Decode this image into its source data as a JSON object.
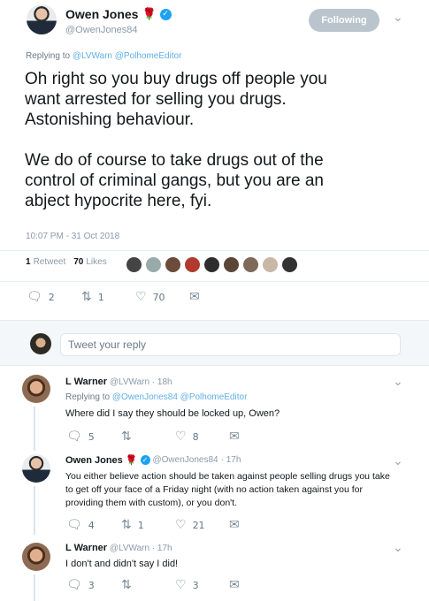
{
  "main_tweet": {
    "author_name": "Owen Jones",
    "handle": "@OwenJones84",
    "follow_label": "Following",
    "replying_to_prefix": "Replying to",
    "replying_to_handles": "@LVWarn @PolhomeEditor",
    "text_line1": "Oh right so you buy drugs off people you",
    "text_line2": "want arrested for selling you drugs.",
    "text_line3": "Astonishing behaviour.",
    "text_line4": "We do of course to take drugs out of the",
    "text_line5": "control of criminal gangs, but you are an",
    "text_line6": "abject hypocrite here, fyi.",
    "timestamp": "10:07 PM - 31 Oct 2018",
    "retweets_count": "1",
    "retweets_label": "Retweet",
    "likes_count": "70",
    "likes_label": "Likes",
    "actions": {
      "replies": "2",
      "retweets": "1",
      "likes": "70"
    }
  },
  "reply_compose": {
    "placeholder": "Tweet your reply"
  },
  "replies": [
    {
      "author_name": "L Warner",
      "handle": "@LVWarn",
      "time": "· 18h",
      "replying_to_prefix": "Replying to",
      "replying_to_handles": "@OwenJones84 @PolhomeEditor",
      "text": "Where did I say they should be locked up, Owen?",
      "actions": {
        "replies": "5",
        "retweets": "",
        "likes": "8"
      }
    },
    {
      "author_name": "Owen Jones",
      "handle": "@OwenJones84",
      "time": "· 17h",
      "text_line1": "You either believe action should be taken against people selling drugs you take",
      "text_line2": "to get off your face of a Friday night (with no action taken against you for",
      "text_line3": "providing them with custom), or you don't.",
      "actions": {
        "replies": "4",
        "retweets": "1",
        "likes": "21"
      }
    },
    {
      "author_name": "L Warner",
      "handle": "@LVWarn",
      "time": "· 17h",
      "text": "I don't and didn't say I did!",
      "actions": {
        "replies": "3",
        "retweets": "",
        "likes": "3"
      }
    }
  ],
  "icons": {
    "reply": "reply-icon",
    "retweet": "retweet-icon",
    "like": "heart-icon",
    "dm": "envelope-icon",
    "caret": "chevron-down-icon",
    "verified": "verified-badge-icon",
    "rose": "rose-icon"
  },
  "colors": {
    "link": "#2b93e0",
    "follow_button": "#b9c4cc",
    "verified": "#1da1f2",
    "rose": "#c0262d"
  }
}
